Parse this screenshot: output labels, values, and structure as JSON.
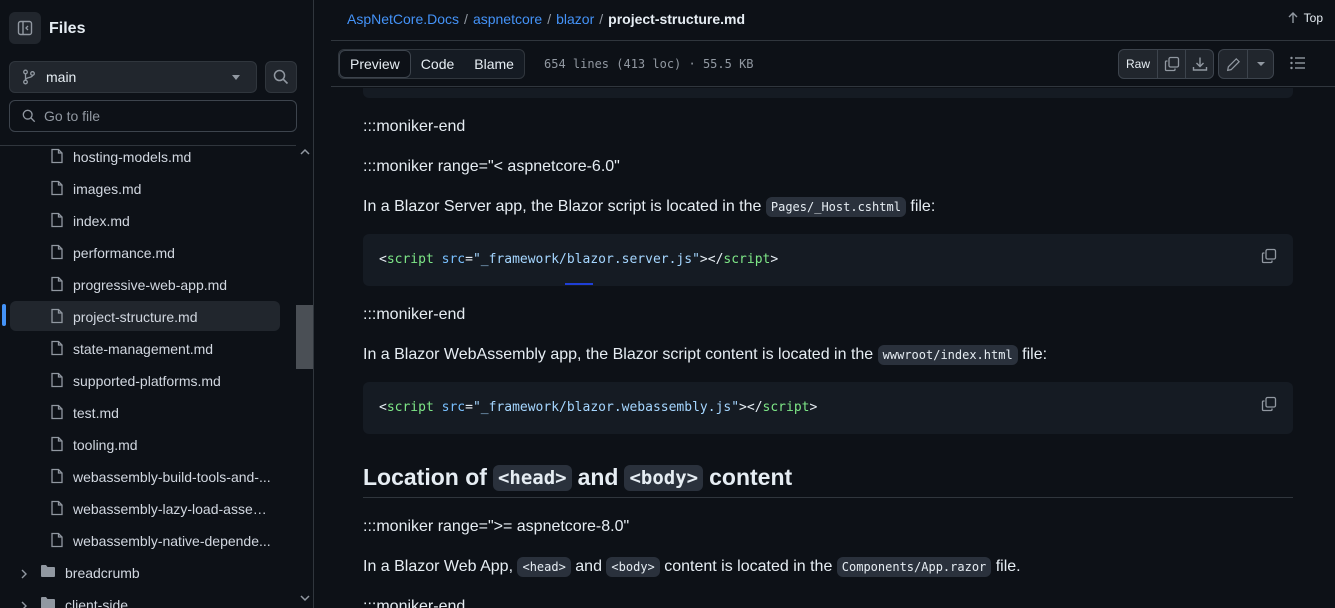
{
  "sidebar": {
    "title": "Files",
    "branch": "main",
    "goto_placeholder": "Go to file",
    "files": [
      "hosting-models.md",
      "images.md",
      "index.md",
      "performance.md",
      "progressive-web-app.md",
      "project-structure.md",
      "state-management.md",
      "supported-platforms.md",
      "test.md",
      "tooling.md",
      "webassembly-build-tools-and-...",
      "webassembly-lazy-load-assem...",
      "webassembly-native-depende..."
    ],
    "active_file": "project-structure.md",
    "folders": [
      "breadcrumb",
      "client-side"
    ]
  },
  "header": {
    "breadcrumb": [
      "AspNetCore.Docs",
      "aspnetcore",
      "blazor"
    ],
    "current_file": "project-structure.md",
    "top_label": "Top"
  },
  "toolbar": {
    "tabs": [
      "Preview",
      "Code",
      "Blame"
    ],
    "selected_tab": "Preview",
    "file_info": "654 lines (413 loc) · 55.5 KB",
    "raw_label": "Raw"
  },
  "content": {
    "p1": ":::moniker-end",
    "p2": ":::moniker range=\"< aspnetcore-6.0\"",
    "p3_before": "In a Blazor Server app, the Blazor script is located in the ",
    "p3_code": "Pages/_Host.cshtml",
    "p3_after": " file:",
    "code1": {
      "open": "<",
      "tag": "script",
      "attr": "src",
      "eq": "=",
      "val": "\"_framework/blazor.server.js\"",
      "close": "></",
      "ctag": "script",
      "end": ">"
    },
    "p4": ":::moniker-end",
    "p5_before": "In a Blazor WebAssembly app, the Blazor script content is located in the ",
    "p5_code": "wwwroot/index.html",
    "p5_after": " file:",
    "code2": {
      "open": "<",
      "tag": "script",
      "attr": "src",
      "eq": "=",
      "val": "\"_framework/blazor.webassembly.js\"",
      "close": "></",
      "ctag": "script",
      "end": ">"
    },
    "h2_a": "Location of",
    "h2_code1": "<head>",
    "h2_b": "and",
    "h2_code2": "<body>",
    "h2_c": "content",
    "p6": ":::moniker range=\">= aspnetcore-8.0\"",
    "p7_a": "In a Blazor Web App, ",
    "p7_c1": "<head>",
    "p7_b": " and ",
    "p7_c2": "<body>",
    "p7_c": " content is located in the ",
    "p7_c3": "Components/App.razor",
    "p7_d": " file.",
    "p8": ":::moniker-end"
  }
}
